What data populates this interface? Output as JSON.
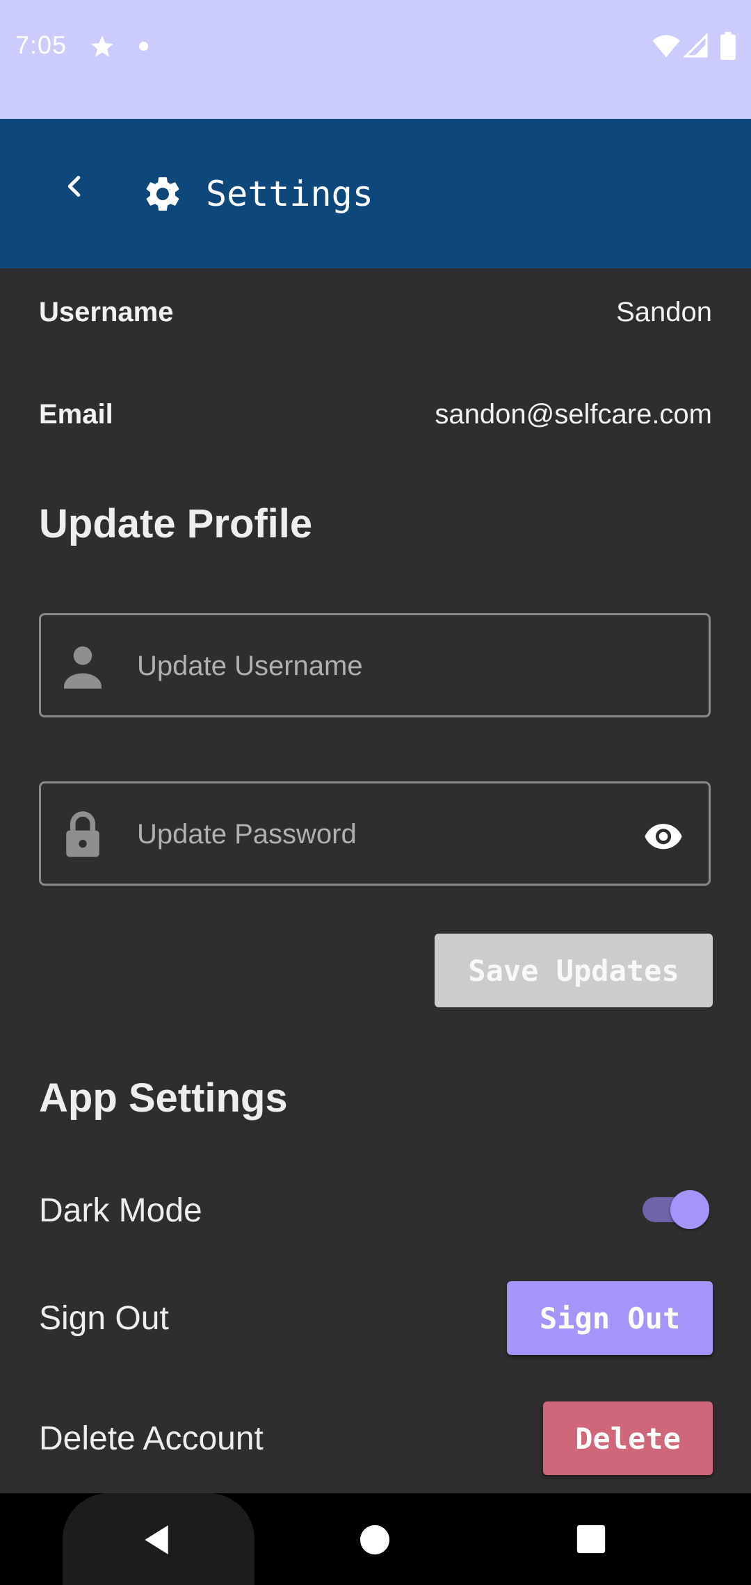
{
  "status_bar": {
    "time": "7:05",
    "icons": [
      "star-icon",
      "dot-icon",
      "wifi-icon",
      "signal-icon",
      "battery-icon"
    ]
  },
  "app_bar": {
    "title": "Settings",
    "back_icon": "chevron-left-icon",
    "title_icon": "gear-icon",
    "background": "#0e477a"
  },
  "account": {
    "username_label": "Username",
    "username_value": "Sandon",
    "email_label": "Email",
    "email_value": "sandon@selfcare.com"
  },
  "update_profile": {
    "heading": "Update Profile",
    "username_placeholder": "Update Username",
    "username_icon": "person-icon",
    "password_placeholder": "Update Password",
    "password_icon": "lock-icon",
    "visibility_icon": "eye-icon",
    "save_label": "Save Updates"
  },
  "app_settings": {
    "heading": "App Settings",
    "dark_mode_label": "Dark Mode",
    "dark_mode_enabled": true,
    "sign_out_label": "Sign Out",
    "sign_out_button": "Sign Out",
    "delete_label": "Delete Account",
    "delete_button": "Delete"
  },
  "colors": {
    "status_bar": "#cccbfe",
    "surface": "#2e2e2e",
    "accent": "#a594f9",
    "danger": "#cf6679",
    "disabled_button": "#cccccc"
  },
  "nav_bar": {
    "buttons": [
      "back-triangle-icon",
      "home-circle-icon",
      "recents-square-icon"
    ]
  }
}
